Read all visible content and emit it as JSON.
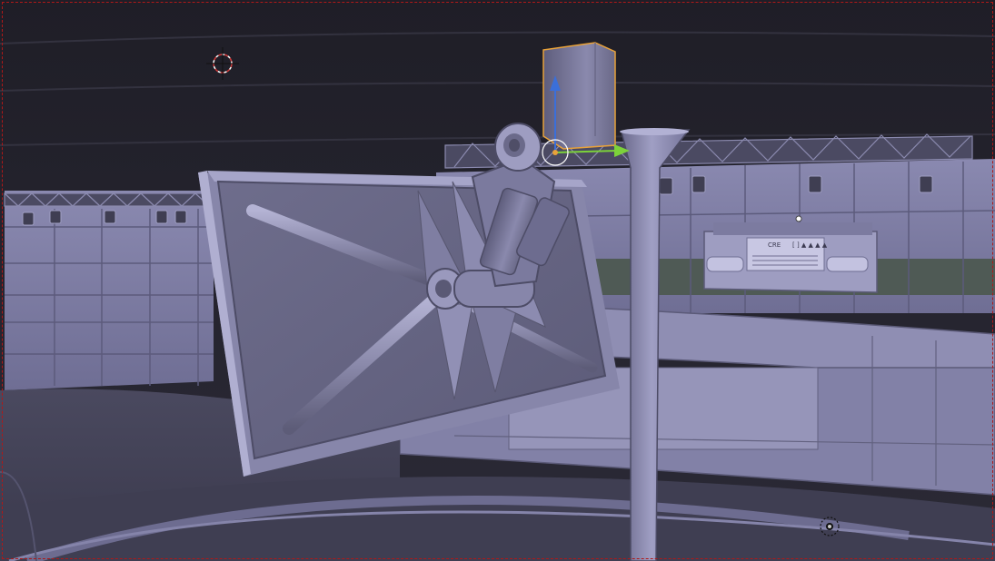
{
  "viewport": {
    "title": "",
    "shading": "solid",
    "colors": {
      "background": "#24232e",
      "studio_surface": "#7f7ea8",
      "studio_dark": "#55546f",
      "selection_outline": "#e8a23a",
      "frame_border": "#b01818",
      "axis_z": "#3b6fd9",
      "axis_y": "#7cd23a",
      "axis_x": "#d84444"
    }
  },
  "scene": {
    "objects": [
      "studio-back-wall",
      "studio-left-wall",
      "lighting-truss",
      "studio-lights",
      "news-desk",
      "desk-sign",
      "spiked-logo-panel",
      "boom-camera-arm",
      "selected-mount",
      "foreground-pillar",
      "studio-floor",
      "floor-ring"
    ],
    "desk_sign_lines": [
      "CRE",
      "[ ] ▲ ▲ ▲ ▲"
    ]
  },
  "gizmo": {
    "axes": [
      "z",
      "y"
    ],
    "icons": [
      "3d-cursor-icon",
      "light-source-icon",
      "transform-gizmo-icon"
    ]
  }
}
